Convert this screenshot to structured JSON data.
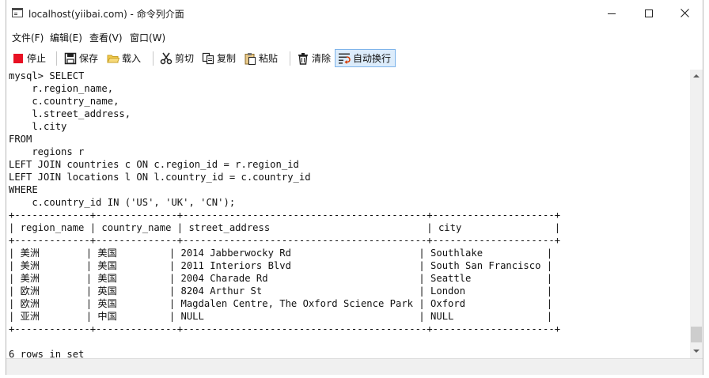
{
  "window": {
    "title": "localhost(yiibai.com) - 命令列介面"
  },
  "menu": [
    "文件(F)",
    "编辑(E)",
    "查看(V)",
    "窗口(W)"
  ],
  "toolbar": {
    "stop": "停止",
    "save": "保存",
    "load": "载入",
    "cut": "剪切",
    "copy": "复制",
    "paste": "粘贴",
    "clear": "清除",
    "wrap": "自动换行"
  },
  "console": {
    "lines": [
      "mysql> SELECT",
      "    r.region_name,",
      "    c.country_name,",
      "    l.street_address,",
      "    l.city",
      "FROM",
      "    regions r",
      "LEFT JOIN countries c ON c.region_id = r.region_id",
      "LEFT JOIN locations l ON l.country_id = c.country_id",
      "WHERE",
      "    c.country_id IN ('US', 'UK', 'CN');",
      "+-------------+--------------+------------------------------------------+---------------------+",
      "| region_name | country_name | street_address                           | city                |",
      "+-------------+--------------+------------------------------------------+---------------------+",
      "| 美洲        | 美国         | 2014 Jabberwocky Rd                      | Southlake           |",
      "| 美洲        | 美国         | 2011 Interiors Blvd                      | South San Francisco |",
      "| 美洲        | 美国         | 2004 Charade Rd                          | Seattle             |",
      "| 欧洲        | 英国         | 8204 Arthur St                           | London              |",
      "| 欧洲        | 英国         | Magdalen Centre, The Oxford Science Park | Oxford              |",
      "| 亚洲        | 中国         | NULL                                     | NULL                |",
      "+-------------+--------------+------------------------------------------+---------------------+",
      "",
      "6 rows in set"
    ]
  },
  "colors": {
    "stop_icon": "#e81123",
    "active_button_bg": "#dcecfb",
    "active_button_border": "#7eb4ea"
  }
}
